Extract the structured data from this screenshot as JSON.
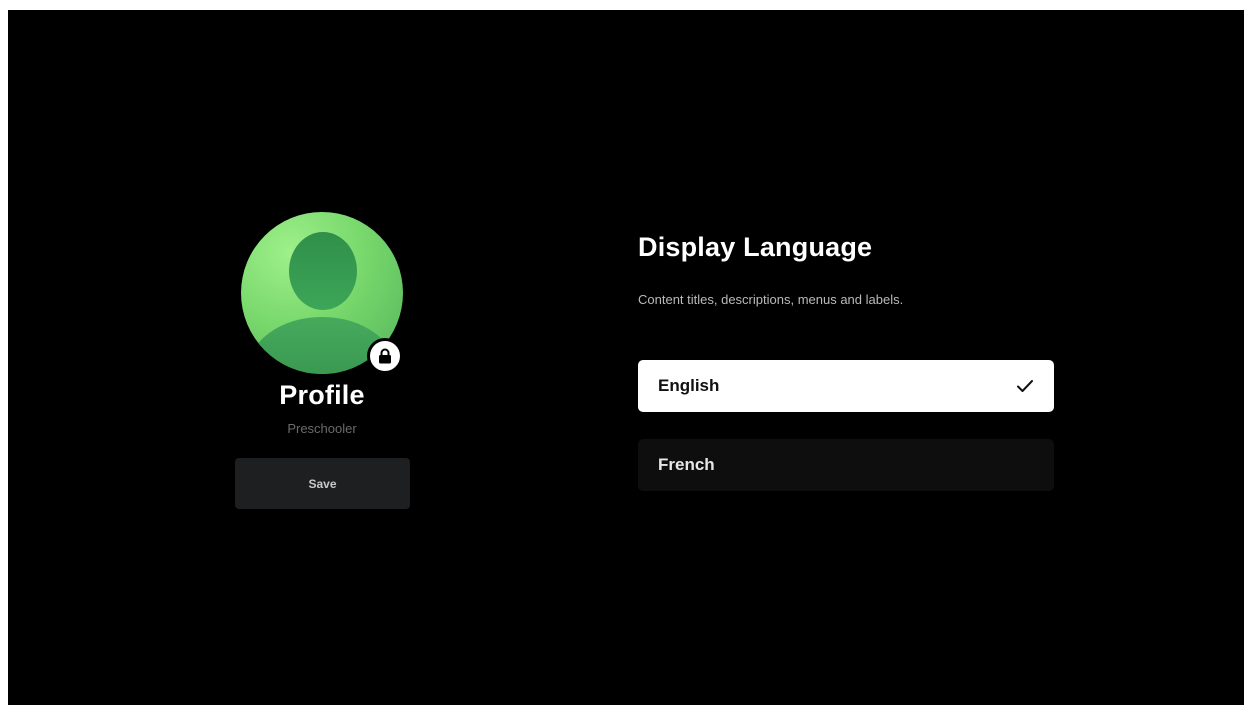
{
  "profile": {
    "name": "Profile",
    "subtitle": "Preschooler",
    "avatar_icon": "avatar-icon",
    "badge_icon": "lock-icon",
    "save_label": "Save"
  },
  "language": {
    "title": "Display Language",
    "description": "Content titles, descriptions, menus and labels.",
    "options": [
      {
        "label": "English",
        "selected": true
      },
      {
        "label": "French",
        "selected": false
      }
    ],
    "selected_icon": "checkmark-icon"
  },
  "colors": {
    "background": "#000000",
    "selected_option_bg": "#ffffff",
    "unselected_option_bg": "#0e0e0e",
    "save_button_bg": "#1d1f21",
    "avatar_accent": "#78d86c"
  }
}
